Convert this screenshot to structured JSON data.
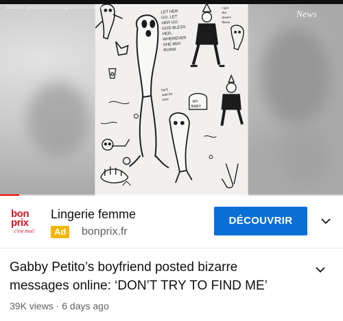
{
  "player": {
    "source_text": "Source: gabspeto(Instagram)/Instagram",
    "overlay_logo": "News",
    "progress_fraction": 0.056,
    "drawing_text": {
      "note_top": "LET HER GO, LET HER GO GOD BLESS HER, WHEREVER SHE MAY ROAM",
      "note_right": "I got the devil's flame",
      "note_mid": "He'll wait for now",
      "stone_label": "MY BABY"
    }
  },
  "ad": {
    "logo_line1": "bon",
    "logo_line2": "prix",
    "logo_line3": "c'est moi!",
    "title": "Lingerie femme",
    "badge": "Ad",
    "domain": "bonprix.fr",
    "cta": "DÉCOUVRIR",
    "brand_color": "#d2172b",
    "cta_color": "#0a6fd6",
    "badge_color": "#f2b600"
  },
  "video": {
    "title": "Gabby Petito’s boyfriend posted bizarre messages online: ‘DON’T TRY TO FIND ME’",
    "meta": "39K views · 6 days ago"
  },
  "icons": {
    "ad_more": "chevron-down-icon",
    "description_expand": "chevron-down-icon"
  }
}
